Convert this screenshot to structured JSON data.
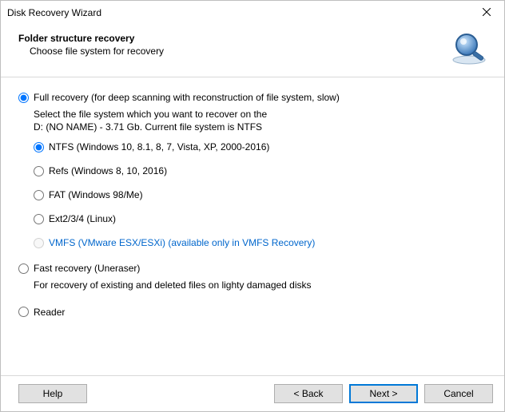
{
  "window": {
    "title": "Disk Recovery Wizard"
  },
  "header": {
    "title": "Folder structure recovery",
    "subtitle": "Choose file system for recovery"
  },
  "modes": {
    "full": {
      "label": "Full recovery (for deep scanning with reconstruction of file system, slow)",
      "desc_line1": "Select the file system which you want to recover on the",
      "desc_line2": "D: (NO NAME) - 3.71 Gb. Current file system is NTFS",
      "fs": {
        "ntfs": "NTFS (Windows 10, 8.1, 8, 7, Vista, XP, 2000-2016)",
        "refs": "Refs (Windows 8, 10, 2016)",
        "fat": "FAT (Windows 98/Me)",
        "ext": "Ext2/3/4 (Linux)",
        "vmfs": "VMFS (VMware ESX/ESXi) (available only in VMFS Recovery)"
      }
    },
    "fast": {
      "label": "Fast recovery (Uneraser)",
      "desc": "For recovery of existing and deleted files on lighty damaged disks"
    },
    "reader": {
      "label": "Reader"
    }
  },
  "buttons": {
    "help": "Help",
    "back": "< Back",
    "next": "Next >",
    "cancel": "Cancel"
  }
}
